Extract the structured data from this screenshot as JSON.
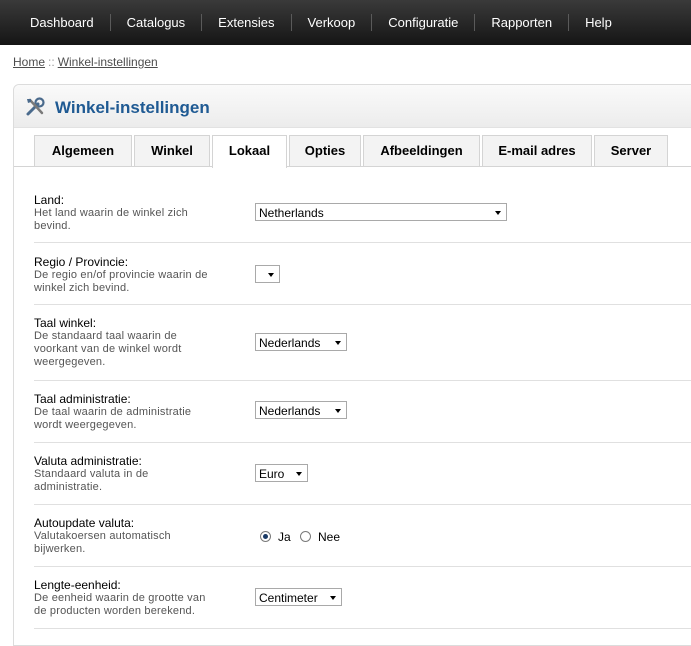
{
  "nav": {
    "items": [
      "Dashboard",
      "Catalogus",
      "Extensies",
      "Verkoop",
      "Configuratie",
      "Rapporten",
      "Help"
    ]
  },
  "breadcrumb": {
    "home": "Home",
    "separator": "::",
    "current": "Winkel-instellingen"
  },
  "panel": {
    "title": "Winkel-instellingen",
    "icon": "tools-icon"
  },
  "tabs": [
    "Algemeen",
    "Winkel",
    "Lokaal",
    "Opties",
    "Afbeeldingen",
    "E-mail adres",
    "Server"
  ],
  "active_tab": "Lokaal",
  "fields": {
    "land": {
      "label": "Land:",
      "desc_lines": [
        "Het land waarin de winkel zich",
        "bevind."
      ],
      "value": "Netherlands"
    },
    "regio": {
      "label": "Regio / Provincie:",
      "desc_lines": [
        "De regio en/of provincie waarin de",
        "winkel zich bevind."
      ],
      "value": ""
    },
    "taal_winkel": {
      "label": "Taal winkel:",
      "desc_lines": [
        "De standaard taal waarin de",
        "voorkant van de winkel wordt",
        "weergegeven."
      ],
      "value": "Nederlands"
    },
    "taal_admin": {
      "label": "Taal administratie:",
      "desc_lines": [
        "De taal waarin de administratie",
        "wordt weergegeven."
      ],
      "value": "Nederlands"
    },
    "valuta_admin": {
      "label": "Valuta administratie:",
      "desc_lines": [
        "Standaard valuta in de",
        "administratie."
      ],
      "value": "Euro"
    },
    "autoupdate": {
      "label": "Autoupdate valuta:",
      "desc_lines": [
        "Valutakoersen automatisch",
        "bijwerken."
      ],
      "options": [
        "Ja",
        "Nee"
      ],
      "selected": "Ja"
    },
    "lengte": {
      "label": "Lengte-eenheid:",
      "desc_lines": [
        "De eenheid waarin de grootte van",
        "de producten worden berekend."
      ],
      "value": "Centimeter"
    }
  }
}
